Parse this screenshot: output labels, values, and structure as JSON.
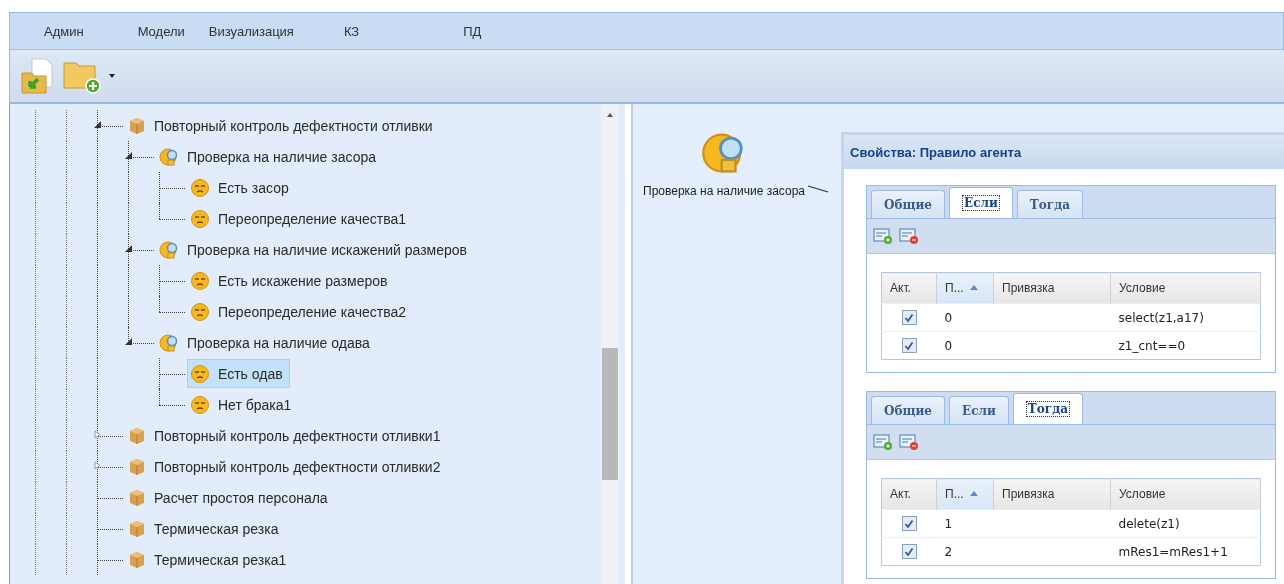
{
  "menu": [
    {
      "label": "Админ"
    },
    {
      "label": "Модели"
    },
    {
      "label": "Визуализация"
    },
    {
      "label": "КЗ"
    },
    {
      "label": "ПД"
    }
  ],
  "tree": [
    {
      "kind": "package",
      "label": "Повторный контроль дефектности отливки",
      "expanded": true,
      "selected": false,
      "children": [
        {
          "kind": "check",
          "label": "Проверка на наличие засора",
          "expanded": true,
          "selected": false,
          "children": [
            {
              "kind": "rule",
              "label": "Есть засор",
              "selected": false
            },
            {
              "kind": "rule",
              "label": "Переопределение качества1",
              "selected": false
            }
          ]
        },
        {
          "kind": "check",
          "label": "Проверка на наличие искажений размеров",
          "expanded": true,
          "selected": false,
          "children": [
            {
              "kind": "rule",
              "label": "Есть искажение размеров",
              "selected": false
            },
            {
              "kind": "rule",
              "label": "Переопределение качества2",
              "selected": false
            }
          ]
        },
        {
          "kind": "check",
          "label": "Проверка на наличие одава",
          "expanded": true,
          "selected": false,
          "children": [
            {
              "kind": "rule",
              "label": "Есть одав",
              "selected": true
            },
            {
              "kind": "rule",
              "label": "Нет брака1",
              "selected": false
            }
          ]
        }
      ]
    },
    {
      "kind": "package",
      "label": "Повторный контроль дефектности отливки1",
      "expanded": false,
      "selected": false
    },
    {
      "kind": "package",
      "label": "Повторный контроль дефектности отливки2",
      "expanded": false,
      "selected": false
    },
    {
      "kind": "package",
      "label": "Расчет простоя персонала",
      "selected": false
    },
    {
      "kind": "package",
      "label": "Термическая резка",
      "selected": false
    },
    {
      "kind": "package",
      "label": "Термическая резка1",
      "selected": false
    }
  ],
  "canvas": {
    "node": {
      "kind": "check",
      "label": "Проверка на наличие засора"
    }
  },
  "properties": {
    "title": "Свойства: Правило агента",
    "panels": [
      {
        "tabs": [
          {
            "label": "Общие",
            "selected": false
          },
          {
            "label": "Если",
            "selected": true
          },
          {
            "label": "Тогда",
            "selected": false
          }
        ],
        "columns": [
          "Акт.",
          "П...",
          "Привязка",
          "Условие"
        ],
        "rows": [
          {
            "checked": true,
            "number": "0",
            "condition": "select(z1,a17)"
          },
          {
            "checked": true,
            "number": "0",
            "condition": "z1_cnt==0"
          }
        ]
      },
      {
        "tabs": [
          {
            "label": "Общие",
            "selected": false
          },
          {
            "label": "Если",
            "selected": false
          },
          {
            "label": "Тогда",
            "selected": true
          }
        ],
        "columns": [
          "Акт.",
          "П...",
          "Привязка",
          "Условие"
        ],
        "rows": [
          {
            "checked": true,
            "number": "1",
            "condition": "delete(z1)"
          },
          {
            "checked": true,
            "number": "2",
            "condition": "mRes1=mRes1+1"
          }
        ]
      }
    ]
  }
}
